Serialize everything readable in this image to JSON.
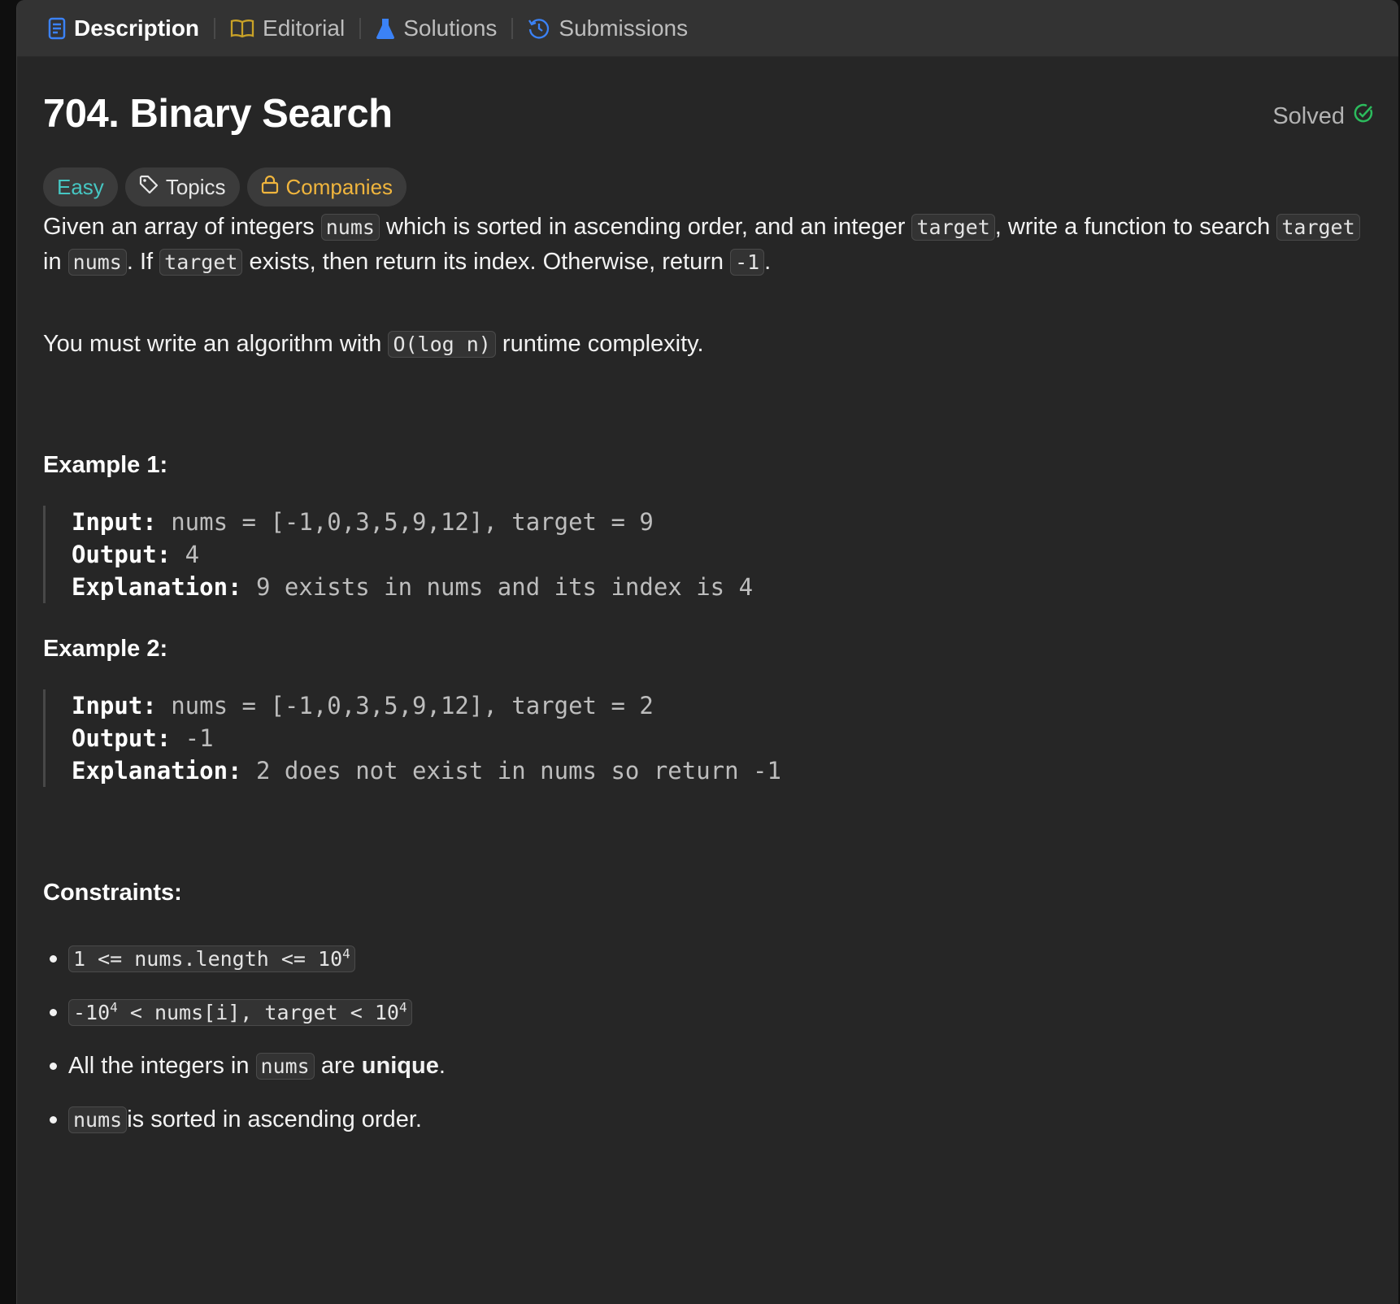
{
  "tabs": [
    {
      "label": "Description",
      "icon": "description-icon",
      "active": true
    },
    {
      "label": "Editorial",
      "icon": "book-icon"
    },
    {
      "label": "Solutions",
      "icon": "flask-icon"
    },
    {
      "label": "Submissions",
      "icon": "history-icon"
    }
  ],
  "problem": {
    "title": "704. Binary Search",
    "status": "Solved",
    "difficulty": "Easy",
    "topics_label": "Topics",
    "companies_label": "Companies",
    "desc1": {
      "t1": "Given an array of integers ",
      "c1": "nums",
      "t2": " which is sorted in ascending order, and an integer ",
      "c2": "target",
      "t3": ", write a function to search ",
      "c3": "target",
      "t4": " in ",
      "c4": "nums",
      "t5": ". If ",
      "c5": "target",
      "t6": " exists, then return its index. Otherwise, return ",
      "c6": "-1",
      "t7": "."
    },
    "desc2": {
      "t1": "You must write an algorithm with ",
      "c1": "O(log n)",
      "t2": " runtime complexity."
    }
  },
  "examples": [
    {
      "heading": "Example 1:",
      "input_label": "Input:",
      "input": " nums = [-1,0,3,5,9,12], target = 9",
      "output_label": "Output:",
      "output": " 4",
      "explanation_label": "Explanation:",
      "explanation": " 9 exists in nums and its index is 4"
    },
    {
      "heading": "Example 2:",
      "input_label": "Input:",
      "input": " nums = [-1,0,3,5,9,12], target = 2",
      "output_label": "Output:",
      "output": " -1",
      "explanation_label": "Explanation:",
      "explanation": " 2 does not exist in nums so return -1"
    }
  ],
  "constraints": {
    "heading": "Constraints:",
    "c1": {
      "pre": "1 <= nums.length <= 10",
      "sup": "4"
    },
    "c2": {
      "pre": "-10",
      "sup1": "4",
      "mid": " < nums[i], target < 10",
      "sup2": "4"
    },
    "c3": {
      "t1": "All the integers in ",
      "code": "nums",
      "t2": " are ",
      "bold": "unique",
      "t3": "."
    },
    "c4": {
      "code": "nums",
      "t1": " is sorted in ascending order."
    }
  },
  "colors": {
    "easy": "#46c6c2",
    "companies": "#f0b53d",
    "solved_check": "#2cbb5d",
    "description_icon": "#3b82f6",
    "editorial_icon": "#c9a227",
    "solutions_icon": "#3b82f6",
    "submissions_icon": "#3b82f6"
  }
}
